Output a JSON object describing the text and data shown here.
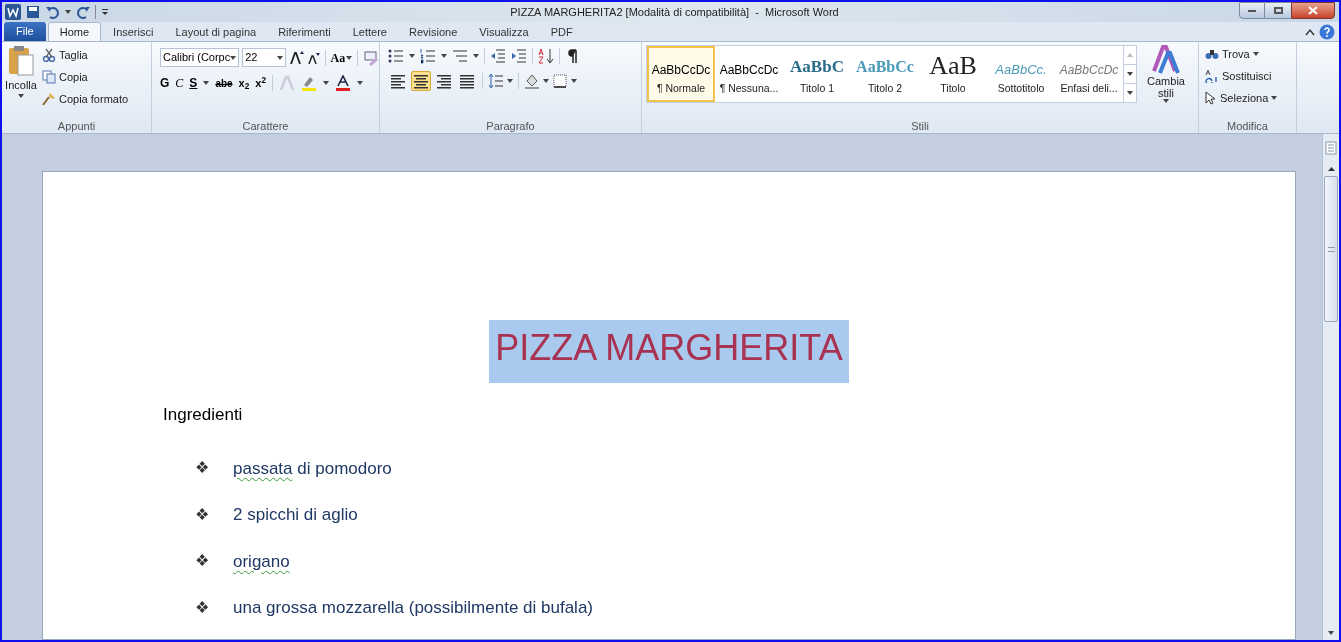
{
  "window": {
    "title": "PIZZA MARGHERITA2 [Modalità di compatibilità]  -  Microsoft Word"
  },
  "tabs": [
    {
      "label": "File",
      "kind": "file",
      "selected": false
    },
    {
      "label": "Home",
      "kind": "tab",
      "selected": true
    },
    {
      "label": "Inserisci",
      "kind": "tab",
      "selected": false
    },
    {
      "label": "Layout di pagina",
      "kind": "tab",
      "selected": false
    },
    {
      "label": "Riferimenti",
      "kind": "tab",
      "selected": false
    },
    {
      "label": "Lettere",
      "kind": "tab",
      "selected": false
    },
    {
      "label": "Revisione",
      "kind": "tab",
      "selected": false
    },
    {
      "label": "Visualizza",
      "kind": "tab",
      "selected": false
    },
    {
      "label": "PDF",
      "kind": "tab",
      "selected": false
    }
  ],
  "clipboard": {
    "label": "Appunti",
    "paste": "Incolla",
    "actions": [
      "Taglia",
      "Copia",
      "Copia formato"
    ]
  },
  "font": {
    "label": "Carattere",
    "family": "Calibri (Corpc",
    "size": "22",
    "case": "Aa",
    "bold": "G",
    "italic": "C",
    "underline": "S",
    "strike": "abe",
    "subscript": "x$_{2}$",
    "superscript": "x$^{2}$"
  },
  "paragraph": {
    "label": "Paragrafo",
    "alignments": [
      {
        "kind": "left",
        "selected": false
      },
      {
        "kind": "center",
        "selected": true
      },
      {
        "kind": "right",
        "selected": false
      },
      {
        "kind": "justify",
        "selected": false
      }
    ]
  },
  "styles": {
    "label": "Stili",
    "items": [
      {
        "preview": "AaBbCcDc",
        "name": "¶ Normale",
        "kind": "normal",
        "selected": true
      },
      {
        "preview": "AaBbCcDc",
        "name": "¶ Nessuna...",
        "kind": "normal",
        "selected": false
      },
      {
        "preview": "AaBbC",
        "name": "Titolo 1",
        "kind": "heading1",
        "selected": false
      },
      {
        "preview": "AaBbCc",
        "name": "Titolo 2",
        "kind": "heading2",
        "selected": false
      },
      {
        "preview": "AaB",
        "name": "Titolo",
        "kind": "title",
        "selected": false
      },
      {
        "preview": "AaBbCc.",
        "name": "Sottotitolo",
        "kind": "subtitle",
        "selected": false
      },
      {
        "preview": "AaBbCcDc",
        "name": "Enfasi deli...",
        "kind": "emphasis",
        "selected": false
      }
    ],
    "change": "Cambia stili"
  },
  "editing": {
    "label": "Modifica",
    "actions": [
      "Trova",
      "Sostituisci",
      "Seleziona"
    ]
  },
  "document": {
    "title": {
      "text": "PIZZA MARGHERITA",
      "selected": true
    },
    "heading": "Ingredienti",
    "items": [
      [
        {
          "text": "passata",
          "flagged": true
        },
        {
          "text": " di pomodoro",
          "flagged": false
        }
      ],
      [
        {
          "text": "2 spicchi di aglio",
          "flagged": false
        }
      ],
      [
        {
          "text": "origano",
          "flagged": true
        }
      ],
      [
        {
          "text": "una grossa mozzarella (possibilmente di bufala)",
          "flagged": false
        }
      ]
    ],
    "bullet": "❖"
  }
}
